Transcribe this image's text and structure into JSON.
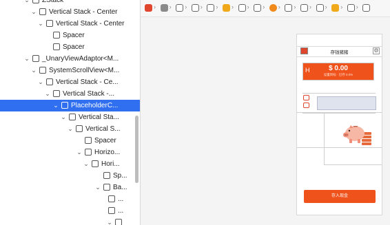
{
  "tree": {
    "rows": [
      {
        "chevron": "⌄",
        "label": "ZStack"
      },
      {
        "chevron": "⌄",
        "label": "Vertical Stack - Center"
      },
      {
        "chevron": "⌄",
        "label": "Vertical Stack - Center"
      },
      {
        "chevron": "",
        "label": "Spacer"
      },
      {
        "chevron": "",
        "label": "Spacer"
      },
      {
        "chevron": "⌄",
        "label": "_UnaryViewAdaptor<M..."
      },
      {
        "chevron": "⌄",
        "label": "SystemScrollView<M..."
      },
      {
        "chevron": "⌄",
        "label": "Vertical Stack - Ce..."
      },
      {
        "chevron": "⌄",
        "label": "Vertical Stack -..."
      },
      {
        "chevron": "⌄",
        "label": "PlaceholderC..."
      },
      {
        "chevron": "⌄",
        "label": "Vertical Sta..."
      },
      {
        "chevron": "⌄",
        "label": "Vertical S..."
      },
      {
        "chevron": "",
        "label": "Spacer"
      },
      {
        "chevron": "⌄",
        "label": "Horizo..."
      },
      {
        "chevron": "⌄",
        "label": "Hori..."
      },
      {
        "chevron": "",
        "label": "Sp..."
      },
      {
        "chevron": "⌄",
        "label": "Ba..."
      },
      {
        "chevron": "",
        "label": "..."
      },
      {
        "chevron": "",
        "label": "..."
      },
      {
        "chevron": "⌄",
        "label": ""
      }
    ],
    "selected_label": "PlaceholderC..."
  },
  "jumpbar": {
    "crumbs": [
      {
        "icon": "app-icon",
        "color": "#e0452e"
      },
      {
        "icon": "window-icon",
        "color": "#8a8a8a"
      },
      {
        "icon": "view-icon"
      },
      {
        "icon": "view-icon"
      },
      {
        "icon": "view-icon"
      },
      {
        "icon": "scene-icon",
        "color": "#f1a91c"
      },
      {
        "icon": "view-icon"
      },
      {
        "icon": "view-icon"
      },
      {
        "icon": "back-icon",
        "color": "#f08a1c"
      },
      {
        "icon": "view-icon"
      },
      {
        "icon": "view-icon"
      },
      {
        "icon": "view-icon"
      },
      {
        "icon": "scene-icon",
        "color": "#f1a91c"
      },
      {
        "icon": "view-icon"
      },
      {
        "icon": "view-icon"
      }
    ]
  },
  "preview": {
    "nav_title": "存钱猪猪",
    "settings_glyph": "⚙",
    "card_h": "H",
    "balance": "$ 0.00",
    "balance_sub": "设置目标 · 已存  0.0%",
    "deposit_button": "存入现金",
    "accent": "#f0521c"
  }
}
